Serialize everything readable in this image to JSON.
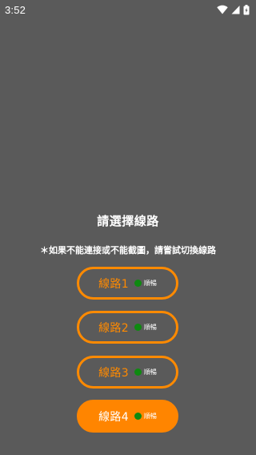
{
  "statusbar": {
    "time": "3:52",
    "icons": [
      "wifi-icon",
      "cell-signal-icon",
      "battery-icon"
    ]
  },
  "title": "請選擇線路",
  "hint": "＊如果不能連接或不能截圖，請嘗試切換線路",
  "routes": [
    {
      "label": "線路1",
      "status": "順暢",
      "active": false
    },
    {
      "label": "線路2",
      "status": "順暢",
      "active": false
    },
    {
      "label": "線路3",
      "status": "順暢",
      "active": false
    },
    {
      "label": "線路4",
      "status": "順暢",
      "active": true
    }
  ],
  "colors": {
    "background": "#5a5a5a",
    "accent": "#ff8a00",
    "status_ok": "#0e8a10"
  }
}
